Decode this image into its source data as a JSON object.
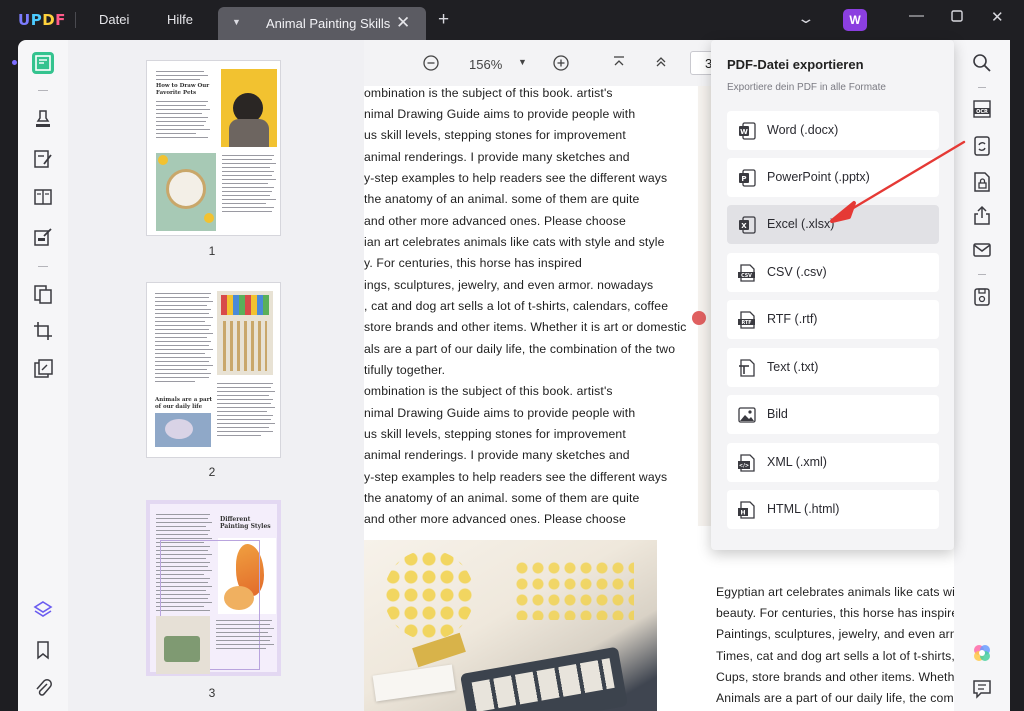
{
  "app": {
    "logo": "UPDF",
    "menu": [
      "Datei",
      "Hilfe"
    ],
    "tab_title": "Animal Painting Skills",
    "tab_close": "✕",
    "tab_add": "+",
    "user_initial": "W"
  },
  "colors": {
    "accent_green": "#34c38f",
    "avatar_purple": "#8b3fe0",
    "arrow_red": "#e53935"
  },
  "thumbnails": {
    "page_numbers": [
      "1",
      "2",
      "3"
    ],
    "page1_heading": "How to Draw Our Favorite Pets",
    "page2_heading": "Animals are a part of our daily life",
    "page3_heading": "Different Painting Styles",
    "selected": "3"
  },
  "zoom": {
    "zoom_out": "−",
    "level": "156%",
    "zoom_in": "+",
    "page_input": "3"
  },
  "document": {
    "lines": [
      "ombination is the subject of this book. artist's",
      "nimal Drawing Guide aims to provide people with",
      "us skill levels, stepping stones for improvement",
      "animal renderings. I provide many sketches and",
      "y-step examples to help readers see the different ways",
      "the anatomy of an animal. some of them are quite",
      "and other more advanced ones. Please choose",
      "ian art celebrates animals like cats with style and style",
      "y. For centuries, this horse has inspired",
      "ings, sculptures, jewelry, and even armor. nowadays",
      ", cat and dog art sells a lot of t-shirts, calendars, coffee",
      "store brands and other items. Whether it is art or domestic",
      "als are a part of our daily life, the combination of the two",
      "tifully together.",
      "ombination is the subject of this book. artist's",
      "nimal Drawing Guide aims to provide people with",
      "us skill levels, stepping stones for improvement",
      "animal renderings. I provide many sketches and",
      "y-step examples to help readers see the different ways",
      "the anatomy of an animal. some of them are quite",
      "and other more advanced ones. Please choose"
    ],
    "right_lines": [
      "Egyptian art celebrates animals like cats with",
      "beauty. For centuries, this horse has inspired",
      "Paintings, sculptures, jewelry, and even armor",
      "Times, cat and dog art sells a lot of t-shirts, c",
      "Cups, store brands and other items. Whether i",
      "Animals are a part of our daily life, the combir"
    ]
  },
  "export_panel": {
    "title": "PDF-Datei exportieren",
    "subtitle": "Exportiere dein PDF in alle Formate",
    "options": [
      {
        "label": "Word (.docx)",
        "icon": "word-icon",
        "badge": "W"
      },
      {
        "label": "PowerPoint (.pptx)",
        "icon": "powerpoint-icon",
        "badge": "P"
      },
      {
        "label": "Excel (.xlsx)",
        "icon": "excel-icon",
        "badge": "X"
      },
      {
        "label": "CSV (.csv)",
        "icon": "csv-icon",
        "badge": "CSV"
      },
      {
        "label": "RTF (.rtf)",
        "icon": "rtf-icon",
        "badge": "RTF"
      },
      {
        "label": "Text (.txt)",
        "icon": "text-icon",
        "badge": "T"
      },
      {
        "label": "Bild",
        "icon": "image-icon",
        "badge": ""
      },
      {
        "label": "XML (.xml)",
        "icon": "xml-icon",
        "badge": "</>"
      },
      {
        "label": "HTML (.html)",
        "icon": "html-icon",
        "badge": "H"
      }
    ],
    "highlighted": "Excel (.xlsx)"
  }
}
